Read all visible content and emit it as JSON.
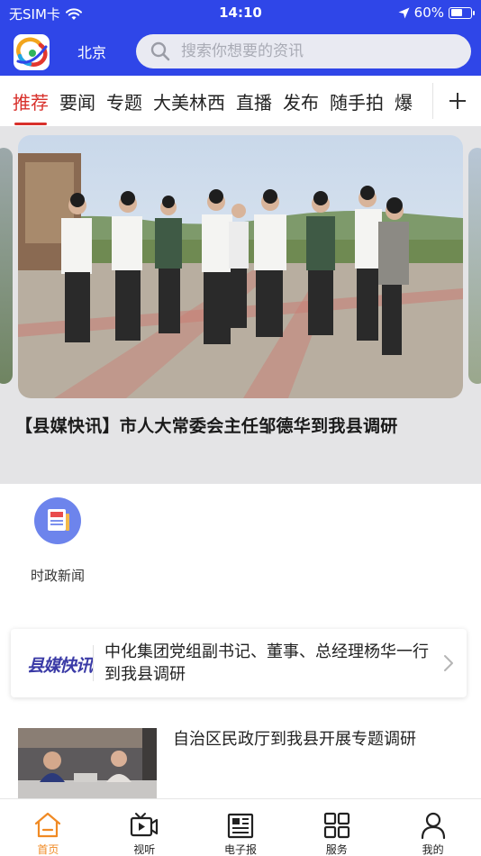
{
  "status_bar": {
    "carrier": "无SIM卡",
    "time": "14:10",
    "battery_percent": "60%",
    "battery_level": 0.6
  },
  "header": {
    "city": "北京",
    "search_placeholder": "搜索你想要的资讯"
  },
  "tabs": [
    "推荐",
    "要闻",
    "专题",
    "大美林西",
    "直播",
    "发布",
    "随手拍",
    "爆"
  ],
  "active_tab_index": 0,
  "hero": {
    "title": "【县媒快讯】市人大常委会主任邹德华到我县调研"
  },
  "quick_entry": {
    "label": "时政新闻",
    "icon": "newspaper-icon"
  },
  "news_card": {
    "brand": "县媒快讯",
    "title": "中化集团党组副书记、董事、总经理杨华一行到我县调研"
  },
  "news_list": [
    {
      "title": "自治区民政厅到我县开展专题调研"
    }
  ],
  "bottom_nav": [
    {
      "label": "首页",
      "icon": "home-icon"
    },
    {
      "label": "视听",
      "icon": "video-icon"
    },
    {
      "label": "电子报",
      "icon": "newspaper-icon"
    },
    {
      "label": "服务",
      "icon": "grid-icon"
    },
    {
      "label": "我的",
      "icon": "user-icon"
    }
  ],
  "active_nav_index": 0,
  "colors": {
    "brand_blue": "#2f46e8",
    "active_tab_red": "#d8302b",
    "active_nav_orange": "#f08a24"
  }
}
